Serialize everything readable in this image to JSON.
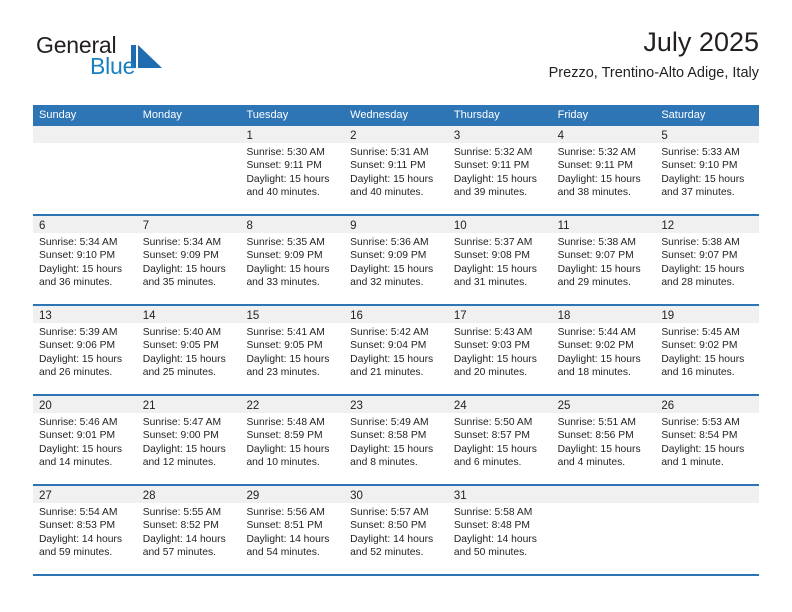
{
  "brand": {
    "word_one": "General",
    "word_two": "Blue",
    "mark_color": "#1f6cb0",
    "word_two_color": "#1a7fc1"
  },
  "header": {
    "title": "July 2025",
    "subtitle": "Prezzo, Trentino-Alto Adige, Italy"
  },
  "theme": {
    "header_blue": "#2e75b6",
    "daynum_band": "#f0f0f0",
    "text": "#231f20"
  },
  "weekdays": [
    "Sunday",
    "Monday",
    "Tuesday",
    "Wednesday",
    "Thursday",
    "Friday",
    "Saturday"
  ],
  "weeks": [
    [
      {
        "day": "",
        "sunrise": "",
        "sunset": "",
        "daylight_1": "",
        "daylight_2": ""
      },
      {
        "day": "",
        "sunrise": "",
        "sunset": "",
        "daylight_1": "",
        "daylight_2": ""
      },
      {
        "day": "1",
        "sunrise": "Sunrise: 5:30 AM",
        "sunset": "Sunset: 9:11 PM",
        "daylight_1": "Daylight: 15 hours",
        "daylight_2": "and 40 minutes."
      },
      {
        "day": "2",
        "sunrise": "Sunrise: 5:31 AM",
        "sunset": "Sunset: 9:11 PM",
        "daylight_1": "Daylight: 15 hours",
        "daylight_2": "and 40 minutes."
      },
      {
        "day": "3",
        "sunrise": "Sunrise: 5:32 AM",
        "sunset": "Sunset: 9:11 PM",
        "daylight_1": "Daylight: 15 hours",
        "daylight_2": "and 39 minutes."
      },
      {
        "day": "4",
        "sunrise": "Sunrise: 5:32 AM",
        "sunset": "Sunset: 9:11 PM",
        "daylight_1": "Daylight: 15 hours",
        "daylight_2": "and 38 minutes."
      },
      {
        "day": "5",
        "sunrise": "Sunrise: 5:33 AM",
        "sunset": "Sunset: 9:10 PM",
        "daylight_1": "Daylight: 15 hours",
        "daylight_2": "and 37 minutes."
      }
    ],
    [
      {
        "day": "6",
        "sunrise": "Sunrise: 5:34 AM",
        "sunset": "Sunset: 9:10 PM",
        "daylight_1": "Daylight: 15 hours",
        "daylight_2": "and 36 minutes."
      },
      {
        "day": "7",
        "sunrise": "Sunrise: 5:34 AM",
        "sunset": "Sunset: 9:09 PM",
        "daylight_1": "Daylight: 15 hours",
        "daylight_2": "and 35 minutes."
      },
      {
        "day": "8",
        "sunrise": "Sunrise: 5:35 AM",
        "sunset": "Sunset: 9:09 PM",
        "daylight_1": "Daylight: 15 hours",
        "daylight_2": "and 33 minutes."
      },
      {
        "day": "9",
        "sunrise": "Sunrise: 5:36 AM",
        "sunset": "Sunset: 9:09 PM",
        "daylight_1": "Daylight: 15 hours",
        "daylight_2": "and 32 minutes."
      },
      {
        "day": "10",
        "sunrise": "Sunrise: 5:37 AM",
        "sunset": "Sunset: 9:08 PM",
        "daylight_1": "Daylight: 15 hours",
        "daylight_2": "and 31 minutes."
      },
      {
        "day": "11",
        "sunrise": "Sunrise: 5:38 AM",
        "sunset": "Sunset: 9:07 PM",
        "daylight_1": "Daylight: 15 hours",
        "daylight_2": "and 29 minutes."
      },
      {
        "day": "12",
        "sunrise": "Sunrise: 5:38 AM",
        "sunset": "Sunset: 9:07 PM",
        "daylight_1": "Daylight: 15 hours",
        "daylight_2": "and 28 minutes."
      }
    ],
    [
      {
        "day": "13",
        "sunrise": "Sunrise: 5:39 AM",
        "sunset": "Sunset: 9:06 PM",
        "daylight_1": "Daylight: 15 hours",
        "daylight_2": "and 26 minutes."
      },
      {
        "day": "14",
        "sunrise": "Sunrise: 5:40 AM",
        "sunset": "Sunset: 9:05 PM",
        "daylight_1": "Daylight: 15 hours",
        "daylight_2": "and 25 minutes."
      },
      {
        "day": "15",
        "sunrise": "Sunrise: 5:41 AM",
        "sunset": "Sunset: 9:05 PM",
        "daylight_1": "Daylight: 15 hours",
        "daylight_2": "and 23 minutes."
      },
      {
        "day": "16",
        "sunrise": "Sunrise: 5:42 AM",
        "sunset": "Sunset: 9:04 PM",
        "daylight_1": "Daylight: 15 hours",
        "daylight_2": "and 21 minutes."
      },
      {
        "day": "17",
        "sunrise": "Sunrise: 5:43 AM",
        "sunset": "Sunset: 9:03 PM",
        "daylight_1": "Daylight: 15 hours",
        "daylight_2": "and 20 minutes."
      },
      {
        "day": "18",
        "sunrise": "Sunrise: 5:44 AM",
        "sunset": "Sunset: 9:02 PM",
        "daylight_1": "Daylight: 15 hours",
        "daylight_2": "and 18 minutes."
      },
      {
        "day": "19",
        "sunrise": "Sunrise: 5:45 AM",
        "sunset": "Sunset: 9:02 PM",
        "daylight_1": "Daylight: 15 hours",
        "daylight_2": "and 16 minutes."
      }
    ],
    [
      {
        "day": "20",
        "sunrise": "Sunrise: 5:46 AM",
        "sunset": "Sunset: 9:01 PM",
        "daylight_1": "Daylight: 15 hours",
        "daylight_2": "and 14 minutes."
      },
      {
        "day": "21",
        "sunrise": "Sunrise: 5:47 AM",
        "sunset": "Sunset: 9:00 PM",
        "daylight_1": "Daylight: 15 hours",
        "daylight_2": "and 12 minutes."
      },
      {
        "day": "22",
        "sunrise": "Sunrise: 5:48 AM",
        "sunset": "Sunset: 8:59 PM",
        "daylight_1": "Daylight: 15 hours",
        "daylight_2": "and 10 minutes."
      },
      {
        "day": "23",
        "sunrise": "Sunrise: 5:49 AM",
        "sunset": "Sunset: 8:58 PM",
        "daylight_1": "Daylight: 15 hours",
        "daylight_2": "and 8 minutes."
      },
      {
        "day": "24",
        "sunrise": "Sunrise: 5:50 AM",
        "sunset": "Sunset: 8:57 PM",
        "daylight_1": "Daylight: 15 hours",
        "daylight_2": "and 6 minutes."
      },
      {
        "day": "25",
        "sunrise": "Sunrise: 5:51 AM",
        "sunset": "Sunset: 8:56 PM",
        "daylight_1": "Daylight: 15 hours",
        "daylight_2": "and 4 minutes."
      },
      {
        "day": "26",
        "sunrise": "Sunrise: 5:53 AM",
        "sunset": "Sunset: 8:54 PM",
        "daylight_1": "Daylight: 15 hours",
        "daylight_2": "and 1 minute."
      }
    ],
    [
      {
        "day": "27",
        "sunrise": "Sunrise: 5:54 AM",
        "sunset": "Sunset: 8:53 PM",
        "daylight_1": "Daylight: 14 hours",
        "daylight_2": "and 59 minutes."
      },
      {
        "day": "28",
        "sunrise": "Sunrise: 5:55 AM",
        "sunset": "Sunset: 8:52 PM",
        "daylight_1": "Daylight: 14 hours",
        "daylight_2": "and 57 minutes."
      },
      {
        "day": "29",
        "sunrise": "Sunrise: 5:56 AM",
        "sunset": "Sunset: 8:51 PM",
        "daylight_1": "Daylight: 14 hours",
        "daylight_2": "and 54 minutes."
      },
      {
        "day": "30",
        "sunrise": "Sunrise: 5:57 AM",
        "sunset": "Sunset: 8:50 PM",
        "daylight_1": "Daylight: 14 hours",
        "daylight_2": "and 52 minutes."
      },
      {
        "day": "31",
        "sunrise": "Sunrise: 5:58 AM",
        "sunset": "Sunset: 8:48 PM",
        "daylight_1": "Daylight: 14 hours",
        "daylight_2": "and 50 minutes."
      },
      {
        "day": "",
        "sunrise": "",
        "sunset": "",
        "daylight_1": "",
        "daylight_2": ""
      },
      {
        "day": "",
        "sunrise": "",
        "sunset": "",
        "daylight_1": "",
        "daylight_2": ""
      }
    ]
  ]
}
